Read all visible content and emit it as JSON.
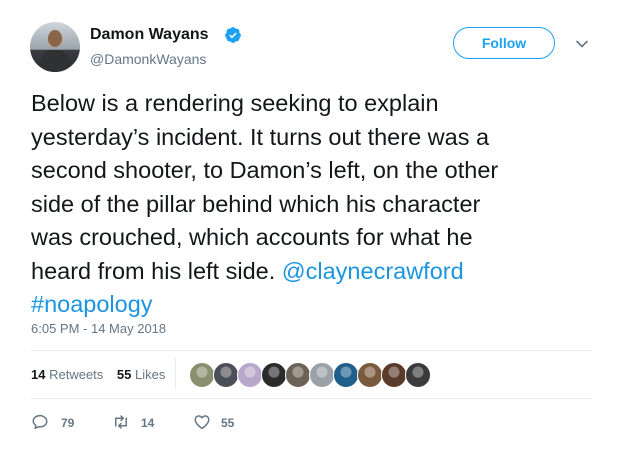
{
  "author": {
    "name": "Damon Wayans",
    "handle": "@DamonkWayans",
    "verified": true
  },
  "follow_button": {
    "label": "Follow"
  },
  "icons": {
    "verified": "verified-badge-icon",
    "caret": "chevron-down-icon",
    "reply": "reply-icon",
    "retweet": "retweet-icon",
    "like": "heart-icon"
  },
  "tweet": {
    "text_lines": [
      "Below is a rendering seeking to explain",
      "yesterday’s incident.  It turns out there was a",
      "second shooter, to Damon’s left, on the other",
      "side of the pillar behind which his character",
      "was crouched, which accounts for what he",
      "heard from his left side. "
    ],
    "mention": "@claynecrawford",
    "hashtag": "#noapology",
    "timestamp": "6:05 PM - 14 May 2018"
  },
  "stats": {
    "retweets_count": "14",
    "retweets_label": "Retweets",
    "likes_count": "55",
    "likes_label": "Likes"
  },
  "liker_avatar_colors": [
    "#8a8f6f",
    "#4b4f57",
    "#b9a7c9",
    "#2b2b2b",
    "#6d6256",
    "#9aa1a8",
    "#1f5f8b",
    "#7a5a3e",
    "#5a3a2a",
    "#3b3b3b"
  ],
  "actions": {
    "replies_count": "79",
    "retweets_count": "14",
    "likes_count": "55"
  },
  "colors": {
    "accent": "#1da1f2",
    "link": "#1b95e0",
    "muted": "#657786"
  }
}
